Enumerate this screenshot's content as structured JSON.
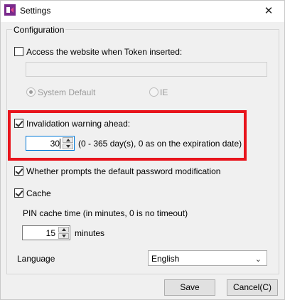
{
  "window": {
    "title": "Settings",
    "close_symbol": "✕"
  },
  "group": {
    "legend": "Configuration"
  },
  "access_website": {
    "label": "Access the website when Token inserted:",
    "checked": false,
    "url_value": "",
    "browser_options": [
      "System Default",
      "IE"
    ],
    "selected_browser": "System Default"
  },
  "invalidation": {
    "label": "Invalidation warning ahead:",
    "checked": true,
    "value": "30",
    "hint": "(0 - 365 day(s), 0 as on the expiration date)"
  },
  "password_prompt": {
    "label": "Whether prompts the default password modification",
    "checked": true
  },
  "cache": {
    "label": "Cache",
    "checked": true,
    "pin_label": "PIN cache time (in minutes, 0 is no timeout)",
    "pin_value": "15",
    "unit": "minutes"
  },
  "language": {
    "label": "Language",
    "selected": "English"
  },
  "buttons": {
    "save": "Save",
    "cancel": "Cancel(C)"
  },
  "colors": {
    "highlight": "#e8141c",
    "focus": "#0078d7",
    "app_icon": "#7a2a8c"
  }
}
